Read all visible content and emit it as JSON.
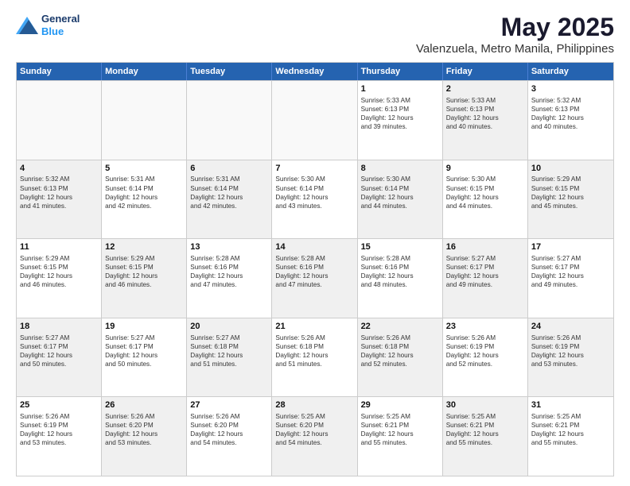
{
  "logo": {
    "line1": "General",
    "line2": "Blue"
  },
  "title": "May 2025",
  "subtitle": "Valenzuela, Metro Manila, Philippines",
  "header_days": [
    "Sunday",
    "Monday",
    "Tuesday",
    "Wednesday",
    "Thursday",
    "Friday",
    "Saturday"
  ],
  "rows": [
    [
      {
        "day": "",
        "content": "",
        "empty": true
      },
      {
        "day": "",
        "content": "",
        "empty": true
      },
      {
        "day": "",
        "content": "",
        "empty": true
      },
      {
        "day": "",
        "content": "",
        "empty": true
      },
      {
        "day": "1",
        "content": "Sunrise: 5:33 AM\nSunset: 6:13 PM\nDaylight: 12 hours\nand 39 minutes.",
        "shaded": false
      },
      {
        "day": "2",
        "content": "Sunrise: 5:33 AM\nSunset: 6:13 PM\nDaylight: 12 hours\nand 40 minutes.",
        "shaded": true
      },
      {
        "day": "3",
        "content": "Sunrise: 5:32 AM\nSunset: 6:13 PM\nDaylight: 12 hours\nand 40 minutes.",
        "shaded": false
      }
    ],
    [
      {
        "day": "4",
        "content": "Sunrise: 5:32 AM\nSunset: 6:13 PM\nDaylight: 12 hours\nand 41 minutes.",
        "shaded": true
      },
      {
        "day": "5",
        "content": "Sunrise: 5:31 AM\nSunset: 6:14 PM\nDaylight: 12 hours\nand 42 minutes.",
        "shaded": false
      },
      {
        "day": "6",
        "content": "Sunrise: 5:31 AM\nSunset: 6:14 PM\nDaylight: 12 hours\nand 42 minutes.",
        "shaded": true
      },
      {
        "day": "7",
        "content": "Sunrise: 5:30 AM\nSunset: 6:14 PM\nDaylight: 12 hours\nand 43 minutes.",
        "shaded": false
      },
      {
        "day": "8",
        "content": "Sunrise: 5:30 AM\nSunset: 6:14 PM\nDaylight: 12 hours\nand 44 minutes.",
        "shaded": true
      },
      {
        "day": "9",
        "content": "Sunrise: 5:30 AM\nSunset: 6:15 PM\nDaylight: 12 hours\nand 44 minutes.",
        "shaded": false
      },
      {
        "day": "10",
        "content": "Sunrise: 5:29 AM\nSunset: 6:15 PM\nDaylight: 12 hours\nand 45 minutes.",
        "shaded": true
      }
    ],
    [
      {
        "day": "11",
        "content": "Sunrise: 5:29 AM\nSunset: 6:15 PM\nDaylight: 12 hours\nand 46 minutes.",
        "shaded": false
      },
      {
        "day": "12",
        "content": "Sunrise: 5:29 AM\nSunset: 6:15 PM\nDaylight: 12 hours\nand 46 minutes.",
        "shaded": true
      },
      {
        "day": "13",
        "content": "Sunrise: 5:28 AM\nSunset: 6:16 PM\nDaylight: 12 hours\nand 47 minutes.",
        "shaded": false
      },
      {
        "day": "14",
        "content": "Sunrise: 5:28 AM\nSunset: 6:16 PM\nDaylight: 12 hours\nand 47 minutes.",
        "shaded": true
      },
      {
        "day": "15",
        "content": "Sunrise: 5:28 AM\nSunset: 6:16 PM\nDaylight: 12 hours\nand 48 minutes.",
        "shaded": false
      },
      {
        "day": "16",
        "content": "Sunrise: 5:27 AM\nSunset: 6:17 PM\nDaylight: 12 hours\nand 49 minutes.",
        "shaded": true
      },
      {
        "day": "17",
        "content": "Sunrise: 5:27 AM\nSunset: 6:17 PM\nDaylight: 12 hours\nand 49 minutes.",
        "shaded": false
      }
    ],
    [
      {
        "day": "18",
        "content": "Sunrise: 5:27 AM\nSunset: 6:17 PM\nDaylight: 12 hours\nand 50 minutes.",
        "shaded": true
      },
      {
        "day": "19",
        "content": "Sunrise: 5:27 AM\nSunset: 6:17 PM\nDaylight: 12 hours\nand 50 minutes.",
        "shaded": false
      },
      {
        "day": "20",
        "content": "Sunrise: 5:27 AM\nSunset: 6:18 PM\nDaylight: 12 hours\nand 51 minutes.",
        "shaded": true
      },
      {
        "day": "21",
        "content": "Sunrise: 5:26 AM\nSunset: 6:18 PM\nDaylight: 12 hours\nand 51 minutes.",
        "shaded": false
      },
      {
        "day": "22",
        "content": "Sunrise: 5:26 AM\nSunset: 6:18 PM\nDaylight: 12 hours\nand 52 minutes.",
        "shaded": true
      },
      {
        "day": "23",
        "content": "Sunrise: 5:26 AM\nSunset: 6:19 PM\nDaylight: 12 hours\nand 52 minutes.",
        "shaded": false
      },
      {
        "day": "24",
        "content": "Sunrise: 5:26 AM\nSunset: 6:19 PM\nDaylight: 12 hours\nand 53 minutes.",
        "shaded": true
      }
    ],
    [
      {
        "day": "25",
        "content": "Sunrise: 5:26 AM\nSunset: 6:19 PM\nDaylight: 12 hours\nand 53 minutes.",
        "shaded": false
      },
      {
        "day": "26",
        "content": "Sunrise: 5:26 AM\nSunset: 6:20 PM\nDaylight: 12 hours\nand 53 minutes.",
        "shaded": true
      },
      {
        "day": "27",
        "content": "Sunrise: 5:26 AM\nSunset: 6:20 PM\nDaylight: 12 hours\nand 54 minutes.",
        "shaded": false
      },
      {
        "day": "28",
        "content": "Sunrise: 5:25 AM\nSunset: 6:20 PM\nDaylight: 12 hours\nand 54 minutes.",
        "shaded": true
      },
      {
        "day": "29",
        "content": "Sunrise: 5:25 AM\nSunset: 6:21 PM\nDaylight: 12 hours\nand 55 minutes.",
        "shaded": false
      },
      {
        "day": "30",
        "content": "Sunrise: 5:25 AM\nSunset: 6:21 PM\nDaylight: 12 hours\nand 55 minutes.",
        "shaded": true
      },
      {
        "day": "31",
        "content": "Sunrise: 5:25 AM\nSunset: 6:21 PM\nDaylight: 12 hours\nand 55 minutes.",
        "shaded": false
      }
    ]
  ]
}
